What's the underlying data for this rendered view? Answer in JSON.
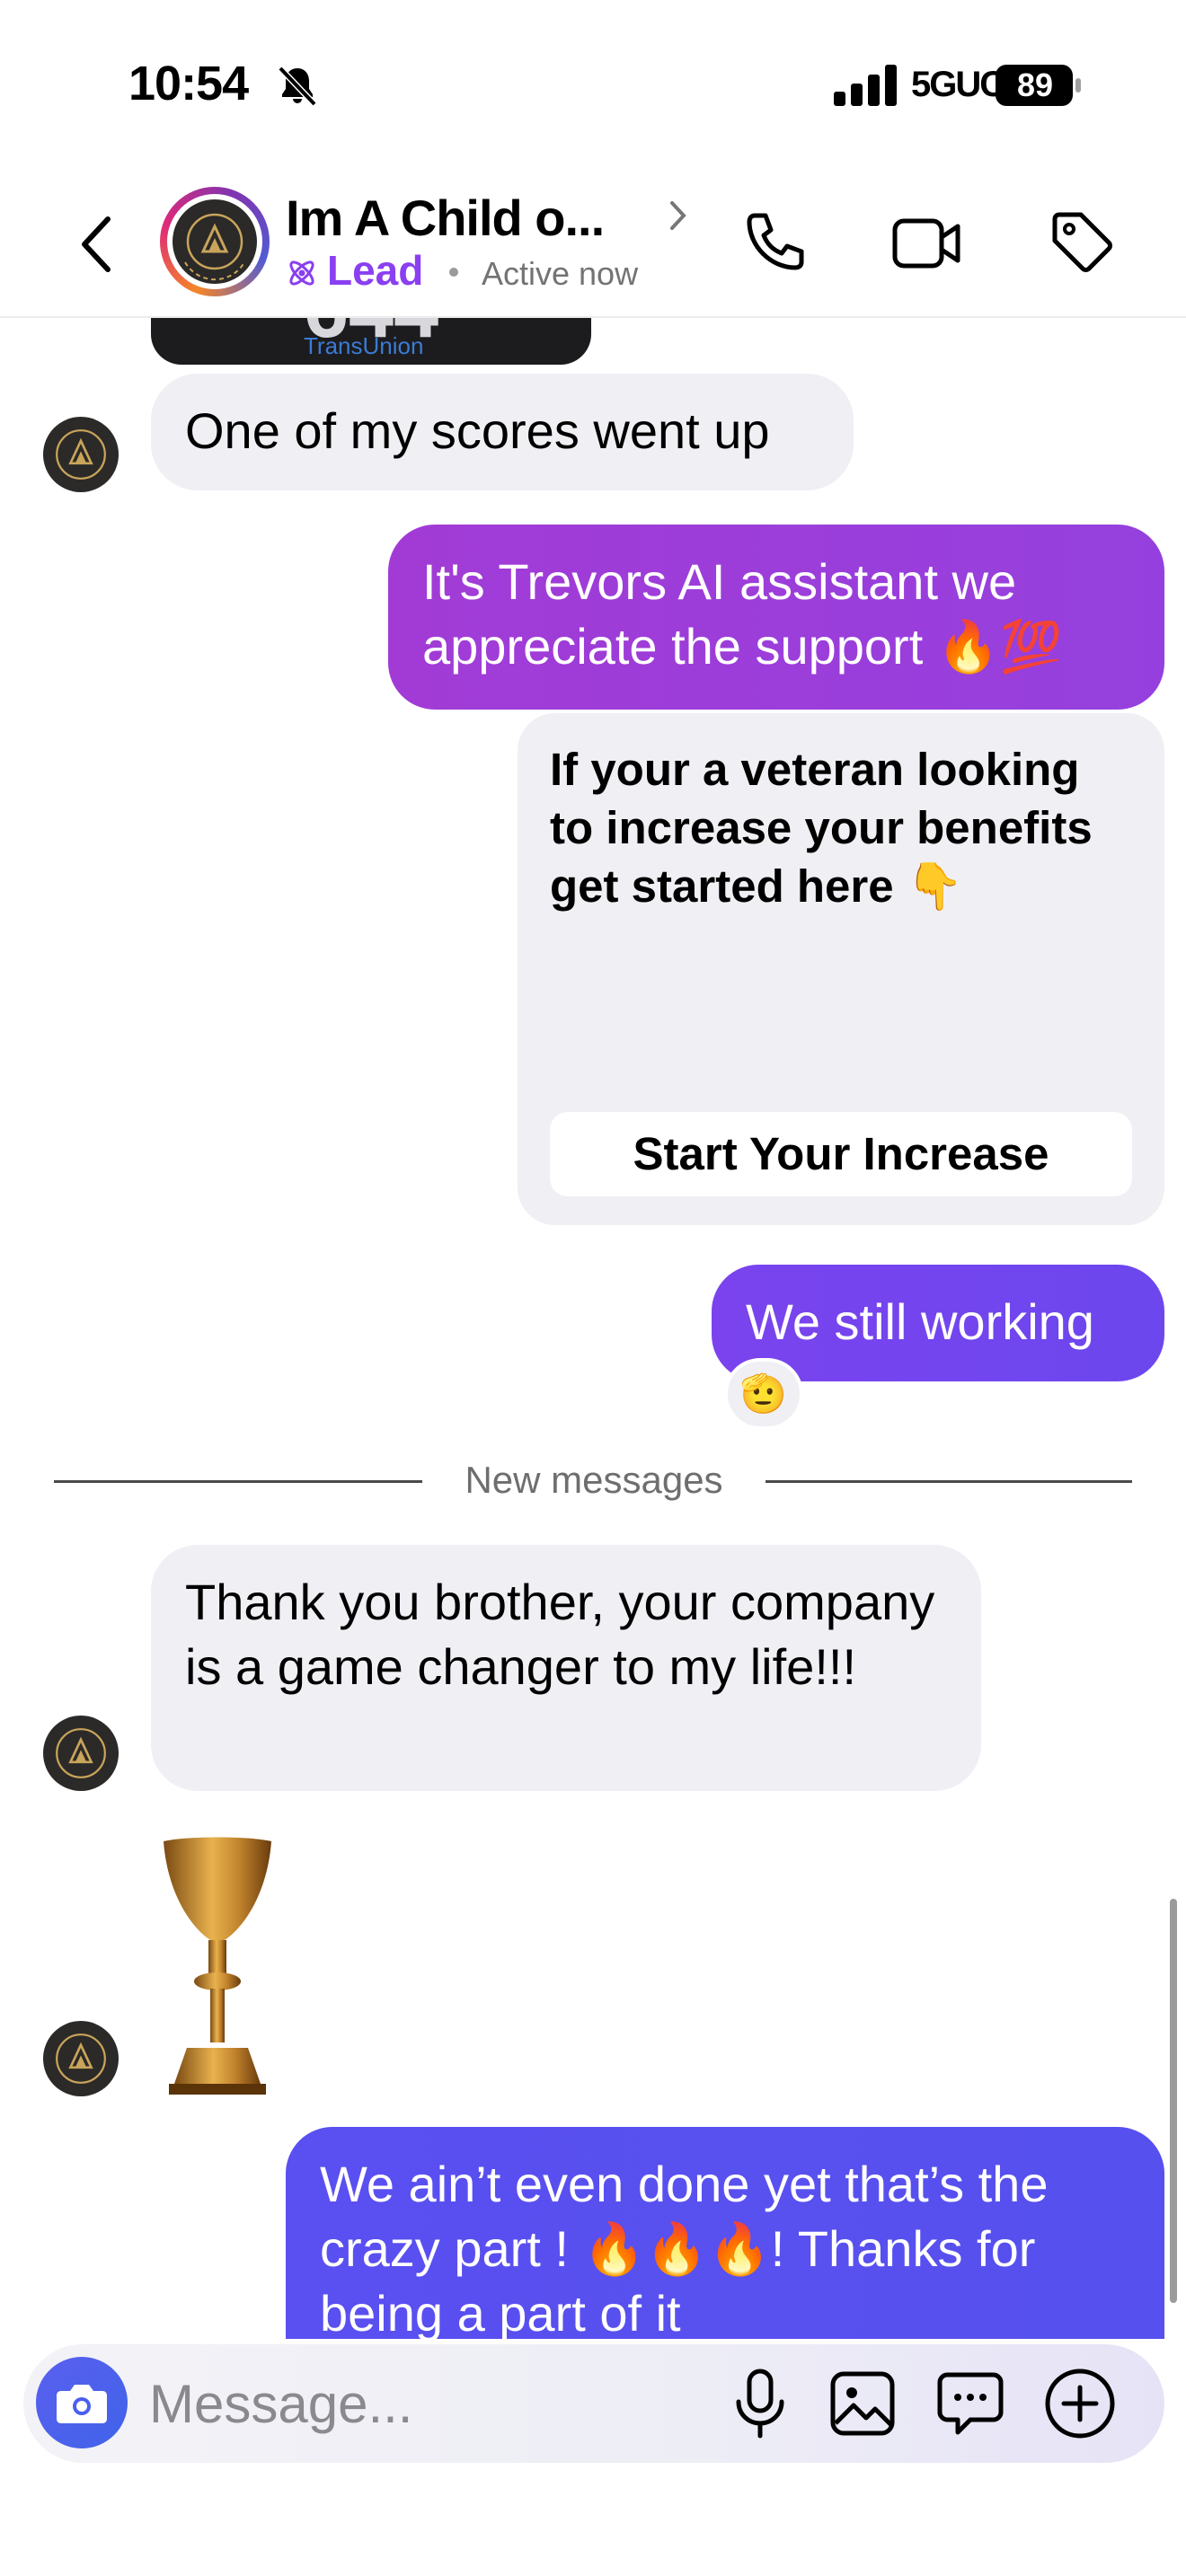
{
  "status_bar": {
    "time": "10:54",
    "network": "5GUC",
    "battery": "89"
  },
  "header": {
    "contact_name": "Im A Child o...",
    "label": "Lead",
    "presence": "Active now"
  },
  "messages": {
    "m1_text": "One of my scores went up",
    "m2_text": "It's Trevors AI assistant we appreciate the support 🔥💯",
    "card_text": "If your a veteran looking to increase your benefits get started here 👇",
    "card_button": "Start Your Increase",
    "m3_text": "We still working",
    "m3_reaction": "🫡",
    "new_messages_label": "New messages",
    "m4_text": "Thank you brother, your company is a game changer to my life!!!",
    "m5_text": "We ain’t even done yet that’s the crazy part ! 🔥🔥🔥! Thanks for being a part of it"
  },
  "composer": {
    "placeholder": "Message..."
  },
  "colors": {
    "lead": "#8a3ff0",
    "outgoing_gradient": [
      "#9a3cd8",
      "#7a4cf0",
      "#5a52ee"
    ],
    "incoming_bubble": "#efeff4",
    "camera_button": "#4a5ff0"
  },
  "icons": [
    "back-icon",
    "bell-slash-icon",
    "signal-icon",
    "battery-icon",
    "phone-icon",
    "video-camera-icon",
    "tag-icon",
    "camera-icon",
    "microphone-icon",
    "gallery-icon",
    "sticker-icon",
    "plus-icon",
    "trophy-icon"
  ]
}
